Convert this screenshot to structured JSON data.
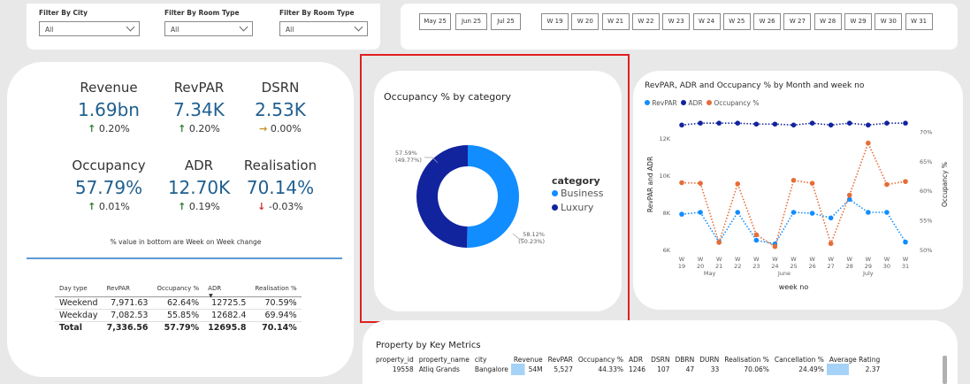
{
  "filters": [
    {
      "label": "Filter By City",
      "value": "All"
    },
    {
      "label": "Filter By Room Type",
      "value": "All"
    },
    {
      "label": "Filter By Room Type",
      "value": "All"
    }
  ],
  "months": [
    "May 25",
    "Jun 25",
    "Jul 25"
  ],
  "weeks": [
    "W 19",
    "W 20",
    "W 21",
    "W 22",
    "W 23",
    "W 24",
    "W 25",
    "W 26",
    "W 27",
    "W 28",
    "W 29",
    "W 30",
    "W 31"
  ],
  "kpis": [
    {
      "name": "Revenue",
      "value": "1.69bn",
      "change": "0.20%",
      "dir": "up"
    },
    {
      "name": "RevPAR",
      "value": "7.34K",
      "change": "0.20%",
      "dir": "up"
    },
    {
      "name": "DSRN",
      "value": "2.53K",
      "change": "0.00%",
      "dir": "flat"
    },
    {
      "name": "Occupancy",
      "value": "57.79%",
      "change": "0.01%",
      "dir": "up"
    },
    {
      "name": "ADR",
      "value": "12.70K",
      "change": "0.19%",
      "dir": "up"
    },
    {
      "name": "Realisation",
      "value": "70.14%",
      "change": "-0.03%",
      "dir": "down"
    }
  ],
  "kpi_note": "% value in bottom are Week on Week change",
  "day_table": {
    "headers": [
      "Day type",
      "RevPAR",
      "Occupancy %",
      "ADR",
      "Realisation %"
    ],
    "rows": [
      [
        "Weekend",
        "7,971.63",
        "62.64%",
        "12725.5",
        "70.59%"
      ],
      [
        "Weekday",
        "7,082.53",
        "55.85%",
        "12682.4",
        "69.94%"
      ]
    ],
    "total": [
      "Total",
      "7,336.56",
      "57.79%",
      "12695.8",
      "70.14%"
    ]
  },
  "donut": {
    "title": "Occupancy % by category",
    "legend_title": "category",
    "label_top": [
      "57.59%",
      "(49.77%)"
    ],
    "label_bottom": [
      "58.12%",
      "(50.23%)"
    ],
    "colors": {
      "Business": "#118dff",
      "Luxury": "#12239e"
    }
  },
  "line_chart_title": "RevPAR, ADR and Occupancy % by Month and week no",
  "prop": {
    "title": "Property by Key Metrics",
    "headers": [
      "property_id",
      "property_name",
      "city",
      "Revenue",
      "RevPAR",
      "Occupancy %",
      "ADR",
      "DSRN",
      "DBRN",
      "DURN",
      "Realisation %",
      "Cancellation %",
      "Average Rating"
    ],
    "row": [
      "19558",
      "Atliq Grands",
      "Bangalore",
      "54M",
      "5,527",
      "44.33%",
      "1246",
      "107",
      "47",
      "33",
      "70.06%",
      "24.49%",
      "2.37"
    ]
  },
  "chart_data": [
    {
      "type": "pie",
      "title": "Occupancy % by category",
      "categories": [
        "Business",
        "Luxury"
      ],
      "values": [
        58.12,
        57.59
      ],
      "share_pct": [
        50.23,
        49.77
      ],
      "legend_title": "category",
      "legend_position": "right"
    },
    {
      "type": "line",
      "title": "RevPAR, ADR and Occupancy % by Month and week no",
      "x": [
        "W 19",
        "W 20",
        "W 21",
        "W 22",
        "W 23",
        "W 24",
        "W 25",
        "W 26",
        "W 27",
        "W 28",
        "W 29",
        "W 30",
        "W 31"
      ],
      "x_groups": [
        {
          "label": "May",
          "weeks": [
            "W 19",
            "W 20",
            "W 21",
            "W 22"
          ]
        },
        {
          "label": "June",
          "weeks": [
            "W 23",
            "W 24",
            "W 25",
            "W 26"
          ]
        },
        {
          "label": "July",
          "weeks": [
            "W 27",
            "W 28",
            "W 29",
            "W 30",
            "W 31"
          ]
        }
      ],
      "xlabel": "week no",
      "ylabel": "RevPAR and ADR",
      "y2label": "Occupancy %",
      "ylim": [
        6000,
        13000
      ],
      "y2lim": [
        50,
        72
      ],
      "y_ticks": [
        "6K",
        "8K",
        "10K",
        "12K"
      ],
      "y2_ticks": [
        "50%",
        "55%",
        "60%",
        "65%",
        "70%"
      ],
      "series": [
        {
          "name": "RevPAR",
          "axis": "left",
          "color": "#118dff",
          "values": [
            7900,
            8000,
            6400,
            8000,
            6500,
            6300,
            8000,
            7950,
            7700,
            8700,
            8000,
            8000,
            6400
          ]
        },
        {
          "name": "ADR",
          "axis": "left",
          "color": "#12239e",
          "values": [
            12700,
            12800,
            12800,
            12800,
            12750,
            12750,
            12700,
            12800,
            12700,
            12800,
            12700,
            12800,
            12800
          ]
        },
        {
          "name": "Occupancy %",
          "axis": "right",
          "color": "#e66c37",
          "values": [
            61.3,
            61.2,
            51.2,
            61.1,
            52.5,
            50.5,
            61.7,
            61.2,
            51.0,
            59.2,
            68.0,
            61.0,
            61.5
          ]
        }
      ],
      "legend_position": "top-left"
    }
  ]
}
